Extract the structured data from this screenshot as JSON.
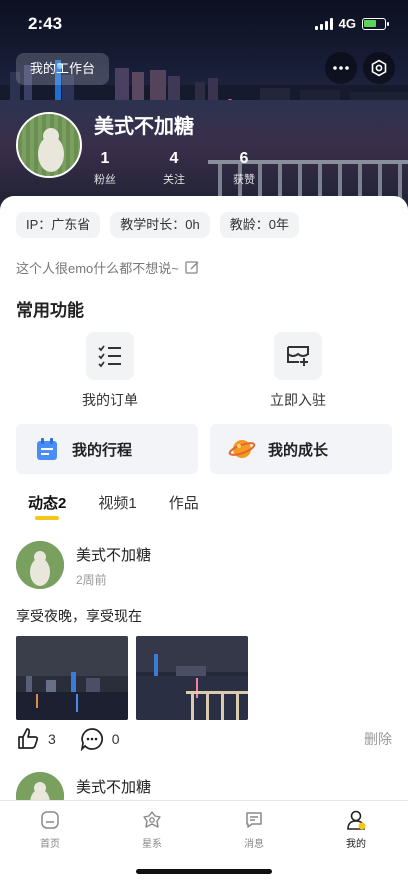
{
  "status_bar": {
    "time": "2:43",
    "network": "4G"
  },
  "header": {
    "workbench_label": "我的工作台",
    "username": "美式不加糖",
    "stats": [
      {
        "value": "1",
        "label": "粉丝"
      },
      {
        "value": "4",
        "label": "关注"
      },
      {
        "value": "6",
        "label": "获赞"
      }
    ]
  },
  "profile": {
    "chips": [
      "IP：广东省",
      "教学时长：0h",
      "教龄：0年"
    ],
    "bio": "这个人很emo什么都不想说~"
  },
  "functions": {
    "title": "常用功能",
    "items": [
      {
        "label": "我的订单",
        "icon": "list-check-icon"
      },
      {
        "label": "立即入驻",
        "icon": "store-add-icon"
      }
    ],
    "cards": [
      {
        "label": "我的行程",
        "icon": "calendar-icon"
      },
      {
        "label": "我的成长",
        "icon": "planet-icon"
      }
    ]
  },
  "content_tabs": [
    {
      "label": "动态2",
      "active": true
    },
    {
      "label": "视频1",
      "active": false
    },
    {
      "label": "作品",
      "active": false
    }
  ],
  "posts": [
    {
      "author": "美式不加糖",
      "time": "2周前",
      "text": "享受夜晚，享受现在",
      "likes": "3",
      "comments": "0",
      "delete_label": "删除"
    },
    {
      "author": "美式不加糖"
    }
  ],
  "tabbar": [
    {
      "label": "首页",
      "icon": "home-icon",
      "active": false
    },
    {
      "label": "星系",
      "icon": "flower-icon",
      "active": false
    },
    {
      "label": "消息",
      "icon": "message-icon",
      "active": false
    },
    {
      "label": "我的",
      "icon": "user-icon",
      "active": true
    }
  ],
  "colors": {
    "accent": "#f5c518",
    "muted": "#999999",
    "chip_bg": "#f2f3f5"
  }
}
